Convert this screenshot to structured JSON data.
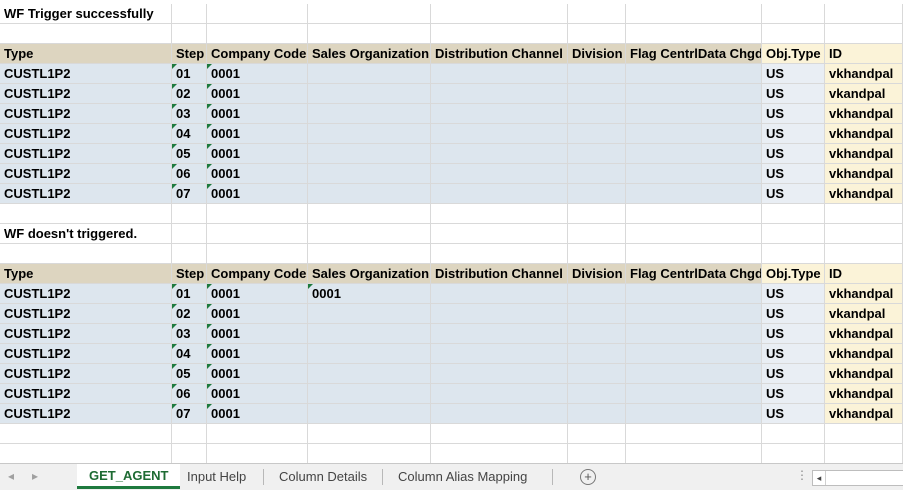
{
  "section1": {
    "title": "WF Trigger successfully",
    "headers": [
      "Type",
      "Step",
      "Company Code",
      "Sales Organization",
      "Distribution Channel",
      "Division",
      "Flag CentrlData Chgd",
      "Obj.Type",
      "ID"
    ],
    "rows": [
      [
        "CUSTL1P2",
        "01",
        "0001",
        "",
        "",
        "",
        "",
        "US",
        "vkhandpal"
      ],
      [
        "CUSTL1P2",
        "02",
        "0001",
        "",
        "",
        "",
        "",
        "US",
        "vkandpal"
      ],
      [
        "CUSTL1P2",
        "03",
        "0001",
        "",
        "",
        "",
        "",
        "US",
        "vkhandpal"
      ],
      [
        "CUSTL1P2",
        "04",
        "0001",
        "",
        "",
        "",
        "",
        "US",
        "vkhandpal"
      ],
      [
        "CUSTL1P2",
        "05",
        "0001",
        "",
        "",
        "",
        "",
        "US",
        "vkhandpal"
      ],
      [
        "CUSTL1P2",
        "06",
        "0001",
        "",
        "",
        "",
        "",
        "US",
        "vkhandpal"
      ],
      [
        "CUSTL1P2",
        "07",
        "0001",
        "",
        "",
        "",
        "",
        "US",
        "vkhandpal"
      ]
    ]
  },
  "section2": {
    "title": "WF doesn't triggered.",
    "headers": [
      "Type",
      "Step",
      "Company Code",
      "Sales Organization",
      "Distribution Channel",
      "Division",
      "Flag CentrlData Chgd",
      "Obj.Type",
      "ID"
    ],
    "rows": [
      [
        "CUSTL1P2",
        "01",
        "0001",
        "0001",
        "",
        "",
        "",
        "US",
        "vkhandpal"
      ],
      [
        "CUSTL1P2",
        "02",
        "0001",
        "",
        "",
        "",
        "",
        "US",
        "vkandpal"
      ],
      [
        "CUSTL1P2",
        "03",
        "0001",
        "",
        "",
        "",
        "",
        "US",
        "vkhandpal"
      ],
      [
        "CUSTL1P2",
        "04",
        "0001",
        "",
        "",
        "",
        "",
        "US",
        "vkhandpal"
      ],
      [
        "CUSTL1P2",
        "05",
        "0001",
        "",
        "",
        "",
        "",
        "US",
        "vkhandpal"
      ],
      [
        "CUSTL1P2",
        "06",
        "0001",
        "",
        "",
        "",
        "",
        "US",
        "vkhandpal"
      ],
      [
        "CUSTL1P2",
        "07",
        "0001",
        "",
        "",
        "",
        "",
        "US",
        "vkhandpal"
      ]
    ]
  },
  "tabs": [
    {
      "label": "GET_AGENT",
      "active": true
    },
    {
      "label": "Input Help",
      "active": false
    },
    {
      "label": "Column Details",
      "active": false
    },
    {
      "label": "Column Alias Mapping",
      "active": false
    }
  ],
  "colors": {
    "header_bg": "#ddd5c0",
    "data_bg": "#dde6ee",
    "id_bg": "#fbf3d8",
    "active_tab": "#1e7a3e"
  },
  "icons": {
    "prev_sheet": "triangle-left-icon",
    "next_sheet": "triangle-right-icon",
    "add_sheet": "plus-circle-icon",
    "text_number_flag": "green-triangle-icon"
  }
}
